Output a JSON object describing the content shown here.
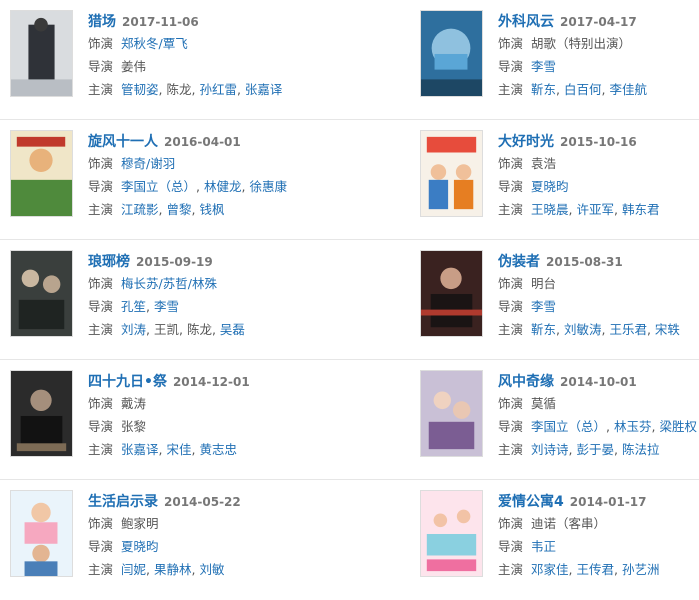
{
  "labels": {
    "role": "饰演",
    "director": "导演",
    "cast": "主演"
  },
  "colors": {
    "link": "#1f6fb4",
    "label": "#555555",
    "date": "#777777",
    "divider": "#e6e6e6"
  },
  "shows": [
    {
      "title": "猎场",
      "date": "2017-11-06",
      "poster_hint": "dark-grayscale",
      "role": [
        {
          "t": "郑秋冬/覃飞",
          "link": true
        }
      ],
      "director": [
        {
          "t": "姜伟",
          "link": false
        }
      ],
      "cast": [
        {
          "t": "管韧姿",
          "link": true
        },
        {
          "t": "陈龙",
          "link": false
        },
        {
          "t": "孙红雷",
          "link": true
        },
        {
          "t": "张嘉译",
          "link": true
        }
      ]
    },
    {
      "title": "外科风云",
      "date": "2017-04-17",
      "poster_hint": "blue-surgeon",
      "role": [
        {
          "t": "胡歌（特别出演）",
          "link": false
        }
      ],
      "director": [
        {
          "t": "李雪",
          "link": true
        }
      ],
      "cast": [
        {
          "t": "靳东",
          "link": true
        },
        {
          "t": "白百何",
          "link": true
        },
        {
          "t": "李佳航",
          "link": true
        }
      ]
    },
    {
      "title": "旋风十一人",
      "date": "2016-04-01",
      "poster_hint": "green-football",
      "role": [
        {
          "t": "穆奇/谢羽",
          "link": true
        }
      ],
      "director": [
        {
          "t": "李国立（总）",
          "link": true
        },
        {
          "t": "林健龙",
          "link": true
        },
        {
          "t": "徐惠康",
          "link": true
        }
      ],
      "cast": [
        {
          "t": "江疏影",
          "link": true
        },
        {
          "t": "曾黎",
          "link": true
        },
        {
          "t": "钱枫",
          "link": true
        }
      ]
    },
    {
      "title": "大好时光",
      "date": "2015-10-16",
      "poster_hint": "bright-comedy",
      "role": [
        {
          "t": "袁浩",
          "link": false
        }
      ],
      "director": [
        {
          "t": "夏晓昀",
          "link": true
        }
      ],
      "cast": [
        {
          "t": "王晓晨",
          "link": true
        },
        {
          "t": "许亚军",
          "link": true
        },
        {
          "t": "韩东君",
          "link": true
        }
      ]
    },
    {
      "title": "琅琊榜",
      "date": "2015-09-19",
      "poster_hint": "dark-costume",
      "role": [
        {
          "t": "梅长苏/苏哲/林殊",
          "link": true
        }
      ],
      "director": [
        {
          "t": "孔笙",
          "link": true
        },
        {
          "t": "李雪",
          "link": true
        }
      ],
      "cast": [
        {
          "t": "刘涛",
          "link": true
        },
        {
          "t": "王凯",
          "link": false
        },
        {
          "t": "陈龙",
          "link": false
        },
        {
          "t": "吴磊",
          "link": true
        }
      ]
    },
    {
      "title": "伪装者",
      "date": "2015-08-31",
      "poster_hint": "dark-red-spy",
      "role": [
        {
          "t": "明台",
          "link": false
        }
      ],
      "director": [
        {
          "t": "李雪",
          "link": true
        }
      ],
      "cast": [
        {
          "t": "靳东",
          "link": true
        },
        {
          "t": "刘敏涛",
          "link": true
        },
        {
          "t": "王乐君",
          "link": true
        },
        {
          "t": "宋轶",
          "link": true
        }
      ]
    },
    {
      "title": "四十九日•祭",
      "date": "2014-12-01",
      "poster_hint": "dark-war",
      "role": [
        {
          "t": "戴涛",
          "link": false
        }
      ],
      "director": [
        {
          "t": "张黎",
          "link": false
        }
      ],
      "cast": [
        {
          "t": "张嘉译",
          "link": true
        },
        {
          "t": "宋佳",
          "link": true
        },
        {
          "t": "黄志忠",
          "link": true
        }
      ]
    },
    {
      "title": "风中奇缘",
      "date": "2014-10-01",
      "poster_hint": "purple-wuxia",
      "role": [
        {
          "t": "莫循",
          "link": false
        }
      ],
      "director": [
        {
          "t": "李国立（总）",
          "link": true
        },
        {
          "t": "林玉芬",
          "link": true
        },
        {
          "t": "梁胜权",
          "link": true
        }
      ],
      "cast": [
        {
          "t": "刘诗诗",
          "link": true
        },
        {
          "t": "彭于晏",
          "link": true
        },
        {
          "t": "陈法拉",
          "link": true
        }
      ]
    },
    {
      "title": "生活启示录",
      "date": "2014-05-22",
      "poster_hint": "light-blue-family",
      "role": [
        {
          "t": "鲍家明",
          "link": false
        }
      ],
      "director": [
        {
          "t": "夏晓昀",
          "link": true
        }
      ],
      "cast": [
        {
          "t": "闫妮",
          "link": true
        },
        {
          "t": "果静林",
          "link": true
        },
        {
          "t": "刘敏",
          "link": true
        }
      ]
    },
    {
      "title": "爱情公寓4",
      "date": "2014-01-17",
      "poster_hint": "pink-sitcom",
      "role": [
        {
          "t": "迪诺（客串）",
          "link": false
        }
      ],
      "director": [
        {
          "t": "韦正",
          "link": true
        }
      ],
      "cast": [
        {
          "t": "邓家佳",
          "link": true
        },
        {
          "t": "王传君",
          "link": true
        },
        {
          "t": "孙艺洲",
          "link": true
        }
      ]
    }
  ]
}
